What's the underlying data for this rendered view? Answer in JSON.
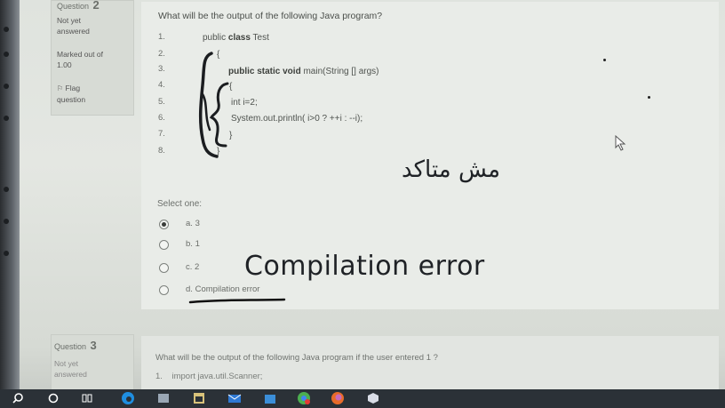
{
  "question2": {
    "label": "Question",
    "number": "2",
    "status": [
      "Not yet",
      "answered"
    ],
    "marks": [
      "Marked out of",
      "1.00"
    ],
    "flag": [
      "Flag",
      "question"
    ],
    "prompt": "What will be the output of the following Java program?",
    "line_numbers": [
      "1.",
      "2.",
      "3.",
      "4.",
      "5.",
      "6.",
      "7.",
      "8."
    ],
    "code": {
      "line1_a": "public ",
      "line1_b": "class",
      "line1_c": " Test",
      "line2": "{",
      "line3_a": "public static void",
      "line3_b": " main",
      "line3_c": "(String [] args)",
      "line4": "{",
      "line5": "int i=2;",
      "line6": "System.out.println( i>0 ? ++i : --i);",
      "line7": "}",
      "line8": "}"
    },
    "select_one": "Select one:",
    "options": [
      {
        "letter": "a.",
        "text": "3",
        "checked": true
      },
      {
        "letter": "b.",
        "text": "1",
        "checked": false
      },
      {
        "letter": "c.",
        "text": "2",
        "checked": false
      },
      {
        "letter": "d.",
        "text": "Compilation error",
        "checked": false
      }
    ],
    "annotation_arabic": "مش متاكد",
    "annotation_english": "Compilation error"
  },
  "question3": {
    "label": "Question",
    "number": "3",
    "status": [
      "Not yet",
      "answered"
    ],
    "prompt": "What will be the output of the following Java program if the user entered 1 ?",
    "code_line1_no": "1.",
    "code_line1": "import java.util.Scanner;"
  },
  "taskbar": {
    "icons": [
      "search-icon",
      "cortana-icon",
      "task-view-icon",
      "edge-icon",
      "app-icon",
      "calendar-icon",
      "mail-icon",
      "store-icon",
      "chrome-icon",
      "firefox-icon",
      "office-icon"
    ]
  },
  "colors": {
    "panel_bg": "#e9ece8",
    "info_bg": "#d7dbd5",
    "taskbar_bg": "#2b3137",
    "ink": "#1f2226"
  }
}
